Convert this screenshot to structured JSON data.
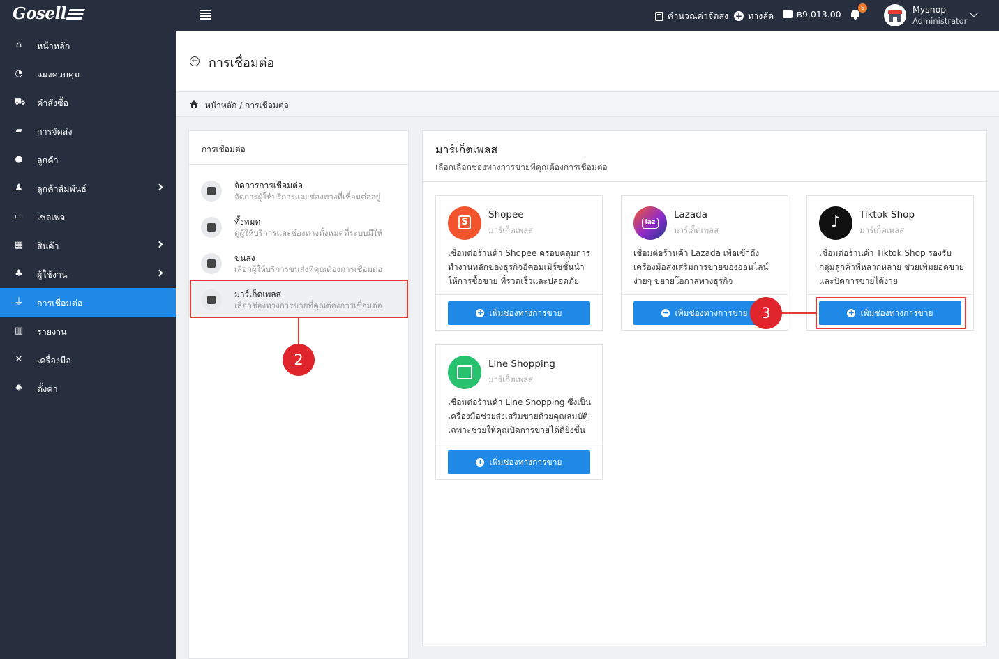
{
  "topbar": {
    "logo": "Gosell",
    "shipping_calc": "คำนวณค่าจัดส่ง",
    "shortcut": "ทางลัด",
    "balance": "฿9,013.00",
    "notif_count": "5",
    "user_name": "Myshop",
    "user_role": "Administrator"
  },
  "sidebar": {
    "items": [
      {
        "label": "หน้าหลัก",
        "icon": "home-icon"
      },
      {
        "label": "แผงควบคุม",
        "icon": "dashboard-icon"
      },
      {
        "label": "คำสั่งซื้อ",
        "icon": "cart-icon"
      },
      {
        "label": "การจัดส่ง",
        "icon": "truck-icon"
      },
      {
        "label": "ลูกค้า",
        "icon": "users-icon"
      },
      {
        "label": "ลูกค้าสัมพันธ์",
        "icon": "user-tie-icon"
      },
      {
        "label": "เซลเพจ",
        "icon": "window-icon"
      },
      {
        "label": "สินค้า",
        "icon": "boxes-icon"
      },
      {
        "label": "ผู้ใช้งาน",
        "icon": "user-gear-icon"
      },
      {
        "label": "การเชื่อมต่อ",
        "icon": "plug-icon"
      },
      {
        "label": "รายงาน",
        "icon": "chart-icon"
      },
      {
        "label": "เครื่องมือ",
        "icon": "tools-icon"
      },
      {
        "label": "ตั้งค่า",
        "icon": "gear-icon"
      }
    ]
  },
  "page": {
    "title": "การเชื่อมต่อ",
    "breadcrumb": "หน้าหลัก / การเชื่อมต่อ"
  },
  "left_panel": {
    "title": "การเชื่อมต่อ",
    "items": [
      {
        "title": "จัดการการเชื่อมต่อ",
        "sub": "จัดการผู้ให้บริการและช่องทางที่เชื่อมต่ออยู่"
      },
      {
        "title": "ทั้งหมด",
        "sub": "ดูผู้ให้บริการและช่องทางทั้งหมดที่ระบบมีให้"
      },
      {
        "title": "ขนส่ง",
        "sub": "เลือกผู้ให้บริการขนส่งที่คุณต้องการเชื่อมต่อ"
      },
      {
        "title": "มาร์เก็ตเพลส",
        "sub": "เลือกช่องทางการขายที่คุณต้องการเชื่อมต่อ"
      }
    ]
  },
  "right_panel": {
    "title": "มาร์เก็ตเพลส",
    "subtitle": "เลือกเลือกช่องทางการขายที่คุณต้องการเชื่อมต่อ",
    "cards": [
      {
        "name": "Shopee",
        "tag": "มาร์เก็ตเพลส",
        "desc": "เชื่อมต่อร้านค้า Shopee ครอบคลุมการทำงานหลักของธุรกิจอีคอมเมิร์ซชั้นนำ ให้การซื้อขาย ที่รวดเร็วและปลอดภัย",
        "button": "เพิ่มช่องทางการขาย"
      },
      {
        "name": "Lazada",
        "tag": "มาร์เก็ตเพลส",
        "desc": "เชื่อมต่อร้านค้า Lazada เพื่อเข้าถึงเครื่องมือส่งเสริมการขายของออนไลน์ง่ายๆ ขยายโอกาสทางธุรกิจ",
        "button": "เพิ่มช่องทางการขาย"
      },
      {
        "name": "Tiktok Shop",
        "tag": "มาร์เก็ตเพลส",
        "desc": "เชื่อมต่อร้านค้า Tiktok Shop รองรับกลุ่มลูกค้าที่หลากหลาย ช่วยเพิ่มยอดขายและปิดการขายได้ง่าย",
        "button": "เพิ่มช่องทางการขาย"
      },
      {
        "name": "Line Shopping",
        "tag": "มาร์เก็ตเพลส",
        "desc": "เชื่อมต่อร้านค้า Line Shopping ซึ่งเป็นเครื่องมือช่วยส่งเสริมขายด้วยคุณสมบัติเฉพาะช่วยให้คุณปิดการขายได้ดียิ่งขึ้น",
        "button": "เพิ่มช่องทางการขาย"
      }
    ]
  },
  "callouts": {
    "step2": "2",
    "step3": "3"
  },
  "colors": {
    "sidebar": "#272f3e",
    "accent": "#1f89e5",
    "callout": "#e0242b"
  }
}
